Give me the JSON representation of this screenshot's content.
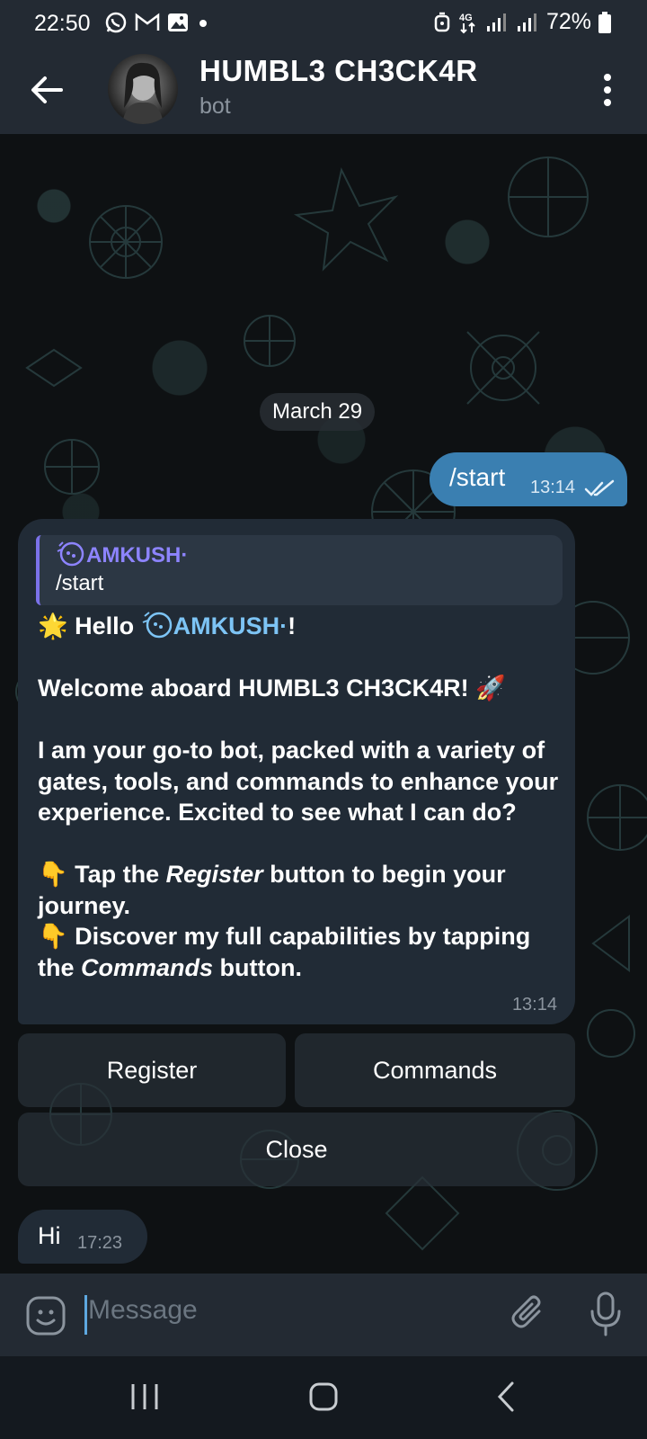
{
  "status_bar": {
    "time": "22:50",
    "network": "4G",
    "battery": "72%",
    "left_icons": [
      "whatsapp-icon",
      "gmail-icon",
      "gallery-icon",
      "dot-icon"
    ],
    "right_icons": [
      "alarm-icon",
      "network-4g-icon",
      "signal-icon",
      "signal-icon",
      "battery-icon"
    ]
  },
  "header": {
    "title": "HUMBL3 CH3CK4R",
    "subtitle": "bot"
  },
  "chat": {
    "date": "March 29",
    "outgoing": {
      "text": "/start",
      "time": "13:14",
      "status": "read"
    },
    "bot_message": {
      "reply_author": "AMKUSH·",
      "reply_text": "/start",
      "line_1_prefix": "🌟 Hello ",
      "mention": "AMKUSH·",
      "line_1_suffix": "!",
      "line_2": "Welcome aboard HUMBL3 CH3CK4R! 🚀",
      "line_3": "I am your go-to bot, packed with a variety of gates, tools, and commands to enhance your experience. Excited to see what I can do?",
      "line_4_prefix": "👇 Tap the ",
      "line_4_emphasis": "Register",
      "line_4_suffix": " button to begin your journey.",
      "line_5_prefix": "👇 Discover my full capabilities by tapping the ",
      "line_5_emphasis": "Commands",
      "line_5_suffix": " button.",
      "time": "13:14"
    },
    "keyboard": {
      "register": "Register",
      "commands": "Commands",
      "close": "Close"
    },
    "incoming_hi": {
      "text": "Hi",
      "time": "17:23"
    }
  },
  "input": {
    "placeholder": "Message"
  },
  "accent_colors": {
    "outgoing_bubble": "#3a7fb1",
    "incoming_bubble": "#212b36",
    "mention": "#7dc4f5",
    "reply_accent": "#7b72e9"
  }
}
